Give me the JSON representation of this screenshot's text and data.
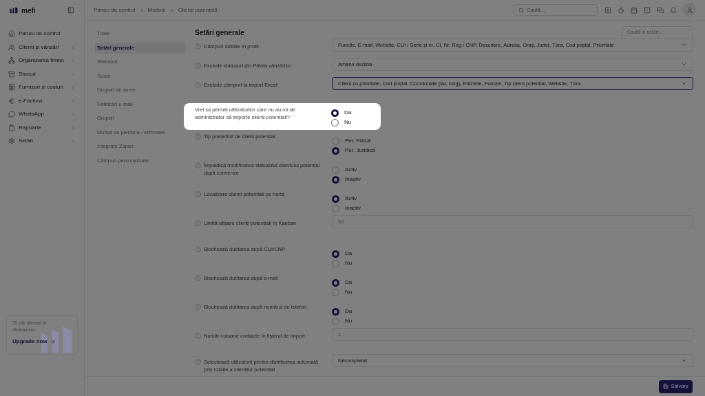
{
  "brand": "mefi",
  "breadcrumb": [
    "Panou de control",
    "Module",
    "Clienți potențiali"
  ],
  "search": {
    "placeholder": "Caută..."
  },
  "sidebar": {
    "items": [
      {
        "label": "Panou de control",
        "expandable": false
      },
      {
        "label": "Clienți și vânzări",
        "expandable": true
      },
      {
        "label": "Organizarea firmei",
        "expandable": true
      },
      {
        "label": "Stocuri",
        "expandable": true
      },
      {
        "label": "Furnizori și costuri",
        "expandable": true
      },
      {
        "label": "e-Factura",
        "expandable": true
      },
      {
        "label": "WhatsApp",
        "expandable": true
      },
      {
        "label": "Rapoarte",
        "expandable": true
      },
      {
        "label": "Setări",
        "expandable": true
      }
    ]
  },
  "subscription": {
    "text": "70 zile rămase în abonament",
    "link": "Upgrade now"
  },
  "subnav": [
    {
      "label": "Toate",
      "selected": false
    },
    {
      "label": "Setări generale",
      "selected": true
    },
    {
      "label": "Statusuri",
      "selected": false
    },
    {
      "label": "Surse",
      "selected": false
    },
    {
      "label": "Grupuri de surse",
      "selected": false
    },
    {
      "label": "Notificări e-mail",
      "selected": false
    },
    {
      "label": "Grupuri",
      "selected": false
    },
    {
      "label": "Motive de pierdere / eliminare",
      "selected": false
    },
    {
      "label": "Integrare Zapier",
      "selected": false
    },
    {
      "label": "Câmpuri personalizate",
      "selected": false
    }
  ],
  "settings": {
    "title": "Setări generale",
    "search_placeholder": "Caută în setări...",
    "rows": [
      {
        "kind": "select",
        "label": "Câmpuri vizibile în profil",
        "value": "Funcție, E-mail, Website, CUI / Serie și nr. CI, Nr. Reg / CNP, Descriere, Adresa, Oraș, Județ, Țara, Cod poștal, Prioritate",
        "focused": false,
        "highlighted": false
      },
      {
        "kind": "select",
        "label": "Exclude statusuri din Pâlnia vânzărilor",
        "value": "Amana decizia",
        "focused": false,
        "highlighted": false
      },
      {
        "kind": "select",
        "label": "Exclude câmpuri la import Excel",
        "value": "Client cu prioritate, Cod poștal, Coordonate (lat, long), Etichete, Funcție, Tip client potențial, Website, Țara",
        "focused": true,
        "highlighted": false
      },
      {
        "kind": "radio",
        "label": "Vrei sa permiți utilizatorilor care nu au rol de administrator să importe clienți potențiali?",
        "highlighted": true,
        "options": [
          {
            "label": "Da",
            "selected": true
          },
          {
            "label": "Nu",
            "selected": false
          }
        ]
      },
      {
        "kind": "radio",
        "label": "Tip predefinit de client potențial",
        "highlighted": false,
        "options": [
          {
            "label": "Per. Fizică",
            "selected": false
          },
          {
            "label": "Per. Juridică",
            "selected": true
          }
        ]
      },
      {
        "kind": "radio",
        "label": "Împiedică modificarea statusului clientului potențial după conversie",
        "highlighted": false,
        "options": [
          {
            "label": "Activ",
            "selected": false
          },
          {
            "label": "Inactiv",
            "selected": true
          }
        ]
      },
      {
        "kind": "radio",
        "label": "Localizare clienți potențiali pe hartă",
        "highlighted": false,
        "options": [
          {
            "label": "Activ",
            "selected": true
          },
          {
            "label": "Inactiv",
            "selected": false
          }
        ]
      },
      {
        "kind": "input",
        "label": "Limită afișare clienți potențiali în Kanban",
        "value": "50",
        "highlighted": false
      },
      {
        "kind": "radio",
        "label": "Blochează dublarea după CUI/CNP",
        "highlighted": false,
        "options": [
          {
            "label": "Da",
            "selected": true
          },
          {
            "label": "Nu",
            "selected": false
          }
        ]
      },
      {
        "kind": "radio",
        "label": "Blochează dublarea după e-mail",
        "highlighted": false,
        "options": [
          {
            "label": "Da",
            "selected": true
          },
          {
            "label": "Nu",
            "selected": false
          }
        ]
      },
      {
        "kind": "radio",
        "label": "Blochează dublarea după numărul de telefon",
        "highlighted": false,
        "options": [
          {
            "label": "Da",
            "selected": true
          },
          {
            "label": "Nu",
            "selected": false
          }
        ]
      },
      {
        "kind": "input",
        "label": "Număr coloane contacte în fișierul de import",
        "value": "2",
        "highlighted": false
      },
      {
        "kind": "select",
        "label": "Selectează utilizatorii pentru distribuirea automată prin rotație a clienților potențiali",
        "value": "Necompletat",
        "focused": false,
        "highlighted": false
      }
    ]
  },
  "save_button": "Salvare"
}
